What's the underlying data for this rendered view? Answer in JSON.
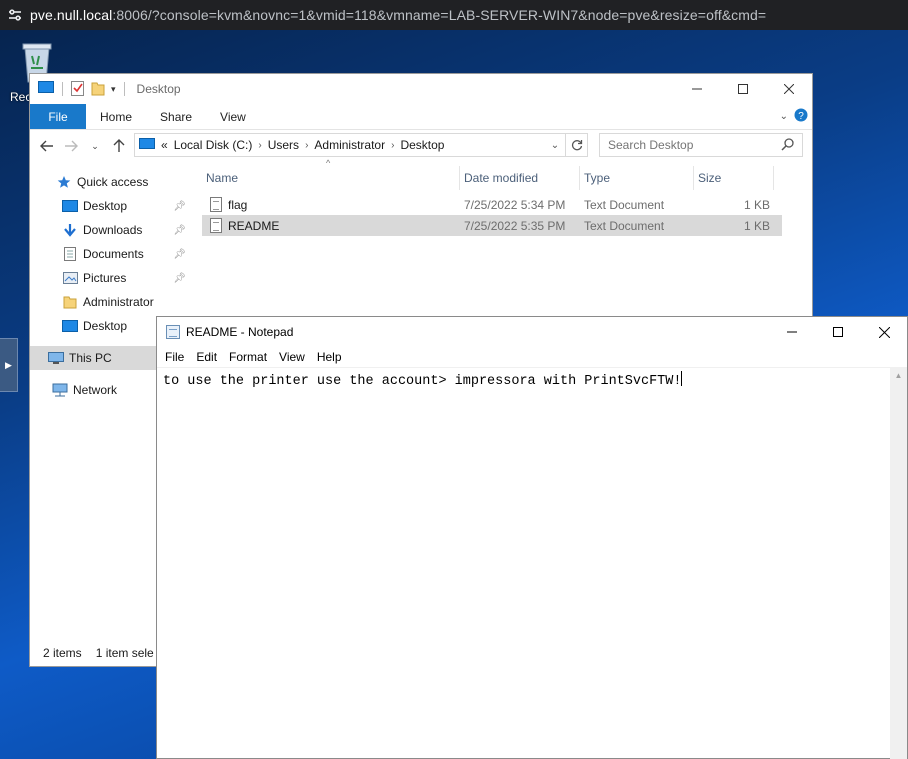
{
  "browser": {
    "url_host": "pve.null.local",
    "url_rest": ":8006/?console=kvm&novnc=1&vmid=118&vmname=LAB-SERVER-WIN7&node=pve&resize=off&cmd="
  },
  "desktop": {
    "recycle_label": "Rec"
  },
  "explorer": {
    "title": "Desktop",
    "ribbon": {
      "file": "File",
      "tabs": [
        "Home",
        "Share",
        "View"
      ]
    },
    "address": {
      "prefix": "«",
      "crumbs": [
        "Local Disk (C:)",
        "Users",
        "Administrator",
        "Desktop"
      ]
    },
    "search_placeholder": "Search Desktop",
    "nav": {
      "quick_access": "Quick access",
      "pinned": [
        "Desktop",
        "Downloads",
        "Documents",
        "Pictures"
      ],
      "recent": [
        "Administrator",
        "Desktop"
      ],
      "this_pc": "This PC",
      "network": "Network"
    },
    "columns": {
      "name": "Name",
      "date": "Date modified",
      "type": "Type",
      "size": "Size"
    },
    "files": [
      {
        "name": "flag",
        "date": "7/25/2022 5:34 PM",
        "type": "Text Document",
        "size": "1 KB"
      },
      {
        "name": "README",
        "date": "7/25/2022 5:35 PM",
        "type": "Text Document",
        "size": "1 KB"
      }
    ],
    "status": {
      "count": "2 items",
      "selected": "1 item sele"
    }
  },
  "notepad": {
    "title": "README - Notepad",
    "menu": [
      "File",
      "Edit",
      "Format",
      "View",
      "Help"
    ],
    "content": "to use the printer use the account> impressora with PrintSvcFTW!"
  },
  "colors": {
    "file_tab": "#1979ca",
    "selection": "#d9d9d9",
    "browser_bar": "#202124"
  }
}
